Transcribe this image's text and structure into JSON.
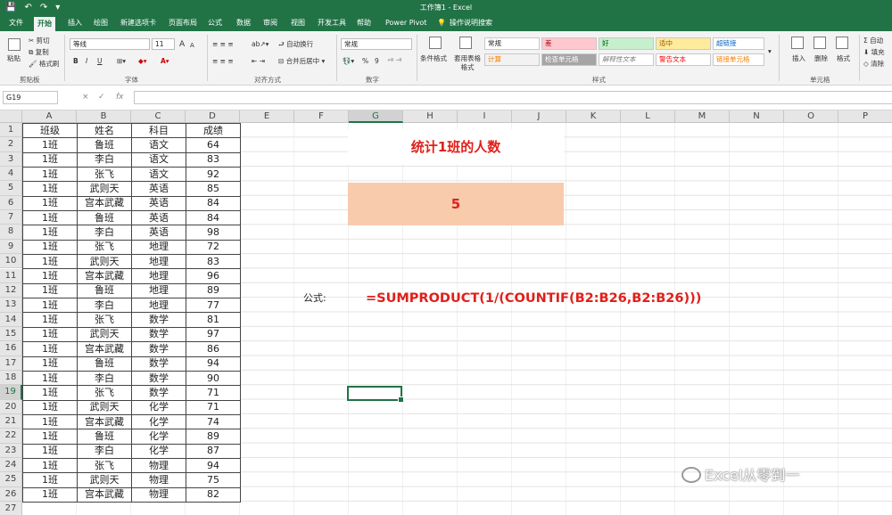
{
  "window": {
    "title": "工作簿1 - Excel"
  },
  "quick_access": {
    "save_icon": "💾",
    "undo_icon": "↶",
    "redo_icon": "↷",
    "customize_icon": "▾"
  },
  "tabs": [
    "文件",
    "开始",
    "插入",
    "绘图",
    "新建选项卡",
    "页面布局",
    "公式",
    "数据",
    "审阅",
    "视图",
    "开发工具",
    "帮助",
    "Power Pivot",
    "操作说明搜索"
  ],
  "ribbon": {
    "clipboard": {
      "paste": "粘贴",
      "cut": "剪切",
      "copy": "复制",
      "format_painter": "格式刷",
      "group": "剪贴板"
    },
    "font": {
      "name": "等线",
      "size": "11",
      "grow": "A",
      "shrink": "A",
      "bold": "B",
      "italic": "I",
      "underline": "U",
      "group": "字体"
    },
    "alignment": {
      "wrap": "自动换行",
      "merge": "合并后居中",
      "group": "对齐方式"
    },
    "number": {
      "format": "常规",
      "percent": "%",
      "comma": "9",
      "group": "数字"
    },
    "styles": {
      "conditional": "条件格式",
      "table": "套用表格格式",
      "cells": [
        {
          "label": "常规",
          "bg": "#ffffff",
          "fg": "#222222"
        },
        {
          "label": "差",
          "bg": "#ffc7ce",
          "fg": "#9c0006"
        },
        {
          "label": "好",
          "bg": "#c6efce",
          "fg": "#006100"
        },
        {
          "label": "适中",
          "bg": "#ffeb9c",
          "fg": "#9c5700"
        },
        {
          "label": "超链接",
          "bg": "#ffffff",
          "fg": "#0563c1"
        },
        {
          "label": "计算",
          "bg": "#f2f2f2",
          "fg": "#fa7d00"
        },
        {
          "label": "检查单元格",
          "bg": "#a5a5a5",
          "fg": "#ffffff"
        },
        {
          "label": "解释性文本",
          "bg": "#ffffff",
          "fg": "#7f7f7f"
        },
        {
          "label": "警告文本",
          "bg": "#ffffff",
          "fg": "#ff0000"
        },
        {
          "label": "链接单元格",
          "bg": "#ffffff",
          "fg": "#fa7d00"
        }
      ],
      "group": "样式"
    },
    "cells_group": {
      "insert": "插入",
      "delete": "删除",
      "format": "格式",
      "group": "单元格"
    },
    "editing": {
      "sum": "Σ 自动",
      "fill": "填充",
      "clear": "清除"
    }
  },
  "formula_bar": {
    "name_box": "G19",
    "cancel": "×",
    "enter": "✓",
    "fx": "fx",
    "value": ""
  },
  "sheet": {
    "columns": [
      "A",
      "B",
      "C",
      "D",
      "E",
      "F",
      "G",
      "H",
      "I",
      "J",
      "K",
      "L",
      "M",
      "N",
      "O",
      "P"
    ],
    "rows": [
      "1",
      "2",
      "3",
      "4",
      "5",
      "6",
      "7",
      "8",
      "9",
      "10",
      "11",
      "12",
      "13",
      "14",
      "15",
      "16",
      "17",
      "18",
      "19",
      "20",
      "21",
      "22",
      "23",
      "24",
      "25",
      "26",
      "27"
    ],
    "selected_col": "G",
    "selected_row": "19",
    "header": [
      "班级",
      "姓名",
      "科目",
      "成绩"
    ],
    "data": [
      [
        "1班",
        "鲁班",
        "语文",
        "64"
      ],
      [
        "1班",
        "李白",
        "语文",
        "83"
      ],
      [
        "1班",
        "张飞",
        "语文",
        "92"
      ],
      [
        "1班",
        "武则天",
        "英语",
        "85"
      ],
      [
        "1班",
        "宫本武藏",
        "英语",
        "84"
      ],
      [
        "1班",
        "鲁班",
        "英语",
        "84"
      ],
      [
        "1班",
        "李白",
        "英语",
        "98"
      ],
      [
        "1班",
        "张飞",
        "地理",
        "72"
      ],
      [
        "1班",
        "武则天",
        "地理",
        "83"
      ],
      [
        "1班",
        "宫本武藏",
        "地理",
        "96"
      ],
      [
        "1班",
        "鲁班",
        "地理",
        "89"
      ],
      [
        "1班",
        "李白",
        "地理",
        "77"
      ],
      [
        "1班",
        "张飞",
        "数学",
        "81"
      ],
      [
        "1班",
        "武则天",
        "数学",
        "97"
      ],
      [
        "1班",
        "宫本武藏",
        "数学",
        "86"
      ],
      [
        "1班",
        "鲁班",
        "数学",
        "94"
      ],
      [
        "1班",
        "李白",
        "数学",
        "90"
      ],
      [
        "1班",
        "张飞",
        "数学",
        "71"
      ],
      [
        "1班",
        "武则天",
        "化学",
        "71"
      ],
      [
        "1班",
        "宫本武藏",
        "化学",
        "74"
      ],
      [
        "1班",
        "鲁班",
        "化学",
        "89"
      ],
      [
        "1班",
        "李白",
        "化学",
        "87"
      ],
      [
        "1班",
        "张飞",
        "物理",
        "94"
      ],
      [
        "1班",
        "武则天",
        "物理",
        "75"
      ],
      [
        "1班",
        "宫本武藏",
        "物理",
        "82"
      ]
    ],
    "title_cell": "统计1班的人数",
    "result_cell": "5",
    "formula_label": "公式:",
    "formula_text": "=SUMPRODUCT(1/(COUNTIF(B2:B26,B2:B26)))"
  },
  "watermark": "Excel从零到一"
}
